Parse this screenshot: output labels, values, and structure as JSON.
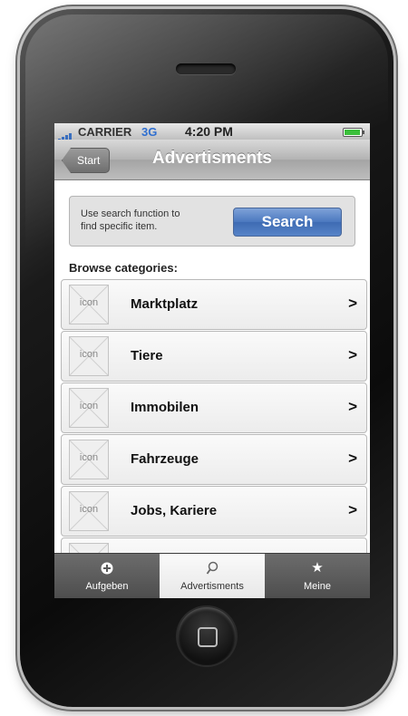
{
  "status_bar": {
    "carrier": "CARRIER",
    "network": "3G",
    "time": "4:20 PM"
  },
  "nav_bar": {
    "back_label": "Start",
    "title": "Advertisments"
  },
  "search": {
    "hint": "Use search function to find specific item.",
    "button_label": "Search"
  },
  "browse_label": "Browse categories:",
  "categories": [
    {
      "icon_text": "icon",
      "name": "Marktplatz",
      "arrow": ">"
    },
    {
      "icon_text": "icon",
      "name": "Tiere",
      "arrow": ">"
    },
    {
      "icon_text": "icon",
      "name": "Immobilen",
      "arrow": ">"
    },
    {
      "icon_text": "icon",
      "name": "Fahrzeuge",
      "arrow": ">"
    },
    {
      "icon_text": "icon",
      "name": "Jobs, Kariere",
      "arrow": ">"
    }
  ],
  "tab_bar": {
    "tabs": [
      {
        "label": "Aufgeben",
        "icon": "plus-circle-icon",
        "active": false
      },
      {
        "label": "Advertisments",
        "icon": "search-icon",
        "active": true
      },
      {
        "label": "Meine",
        "icon": "star-icon",
        "active": false
      }
    ]
  },
  "colors": {
    "nav_bar": "#b3b3b3",
    "search_button": "#4b78bf",
    "tab_bar": "#5a5a5a",
    "tab_active": "#f0f0f0"
  }
}
